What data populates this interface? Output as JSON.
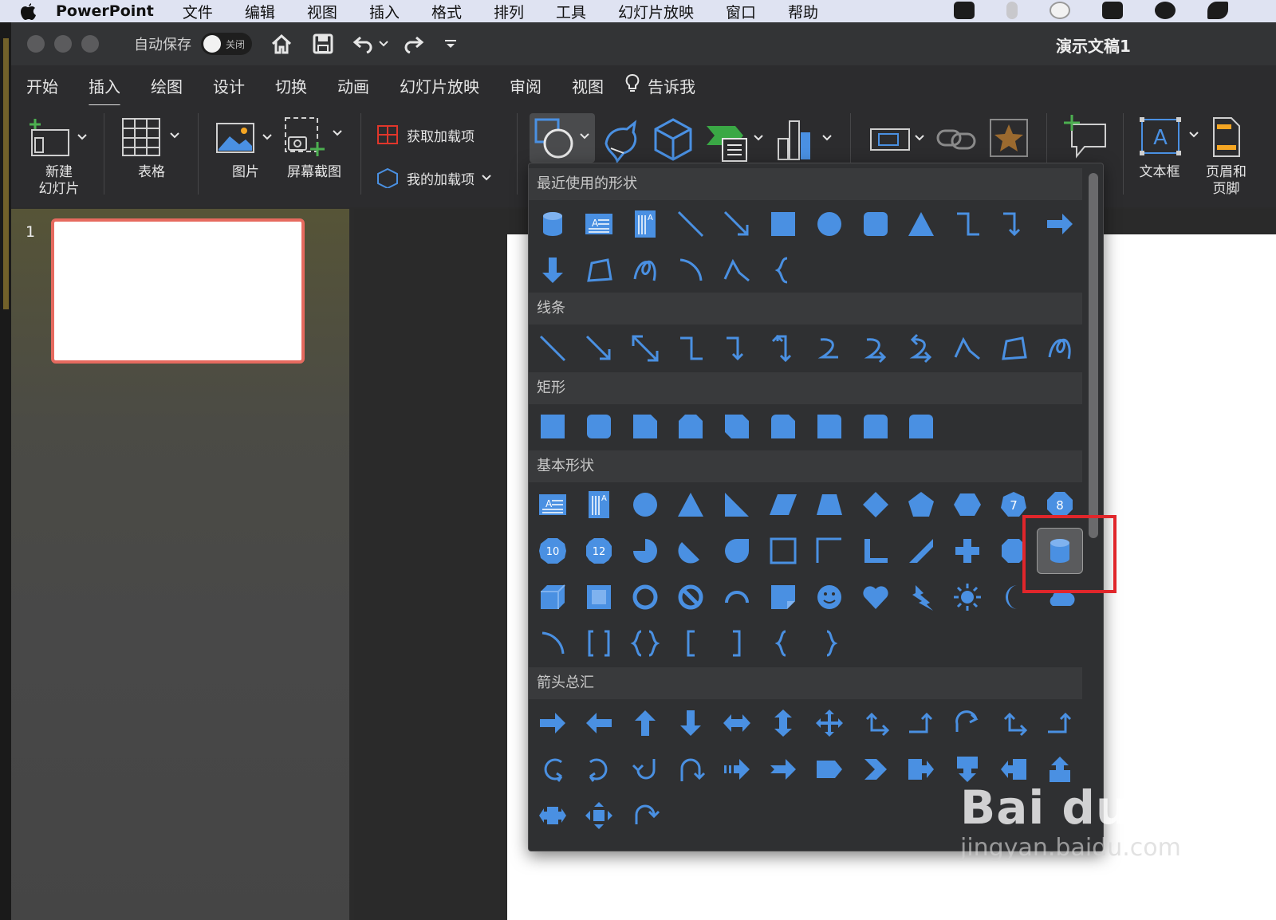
{
  "menubar": {
    "app": "PowerPoint",
    "items": [
      "文件",
      "编辑",
      "视图",
      "插入",
      "格式",
      "排列",
      "工具",
      "幻灯片放映",
      "窗口",
      "帮助"
    ]
  },
  "titlebar": {
    "autosave_label": "自动保存",
    "toggle_label": "关闭",
    "doc_title": "演示文稿1"
  },
  "tabs": {
    "items": [
      "开始",
      "插入",
      "绘图",
      "设计",
      "切换",
      "动画",
      "幻灯片放映",
      "审阅",
      "视图"
    ],
    "active": "插入",
    "tell_me": "告诉我"
  },
  "ribbon": {
    "new_slide": "新建\n幻灯片",
    "table": "表格",
    "picture": "图片",
    "screenshot": "屏幕截图",
    "get_addins": "获取加载项",
    "my_addins": "我的加载项",
    "textbox": "文本框",
    "header_footer": "页眉和\n页脚"
  },
  "slides": {
    "count_label": "1"
  },
  "gallery": {
    "sections": {
      "recent": "最近使用的形状",
      "lines": "线条",
      "rectangles": "矩形",
      "basic": "基本形状",
      "arrows": "箭头总汇"
    },
    "numbers": {
      "hept": "7",
      "oct": "8",
      "dec": "10",
      "dodec": "12"
    }
  },
  "watermark": {
    "brand": "Bai du 经验",
    "url": "jingyan.baidu.com"
  },
  "colors": {
    "accent": "#4a90e2",
    "highlight": "#e0262b"
  }
}
